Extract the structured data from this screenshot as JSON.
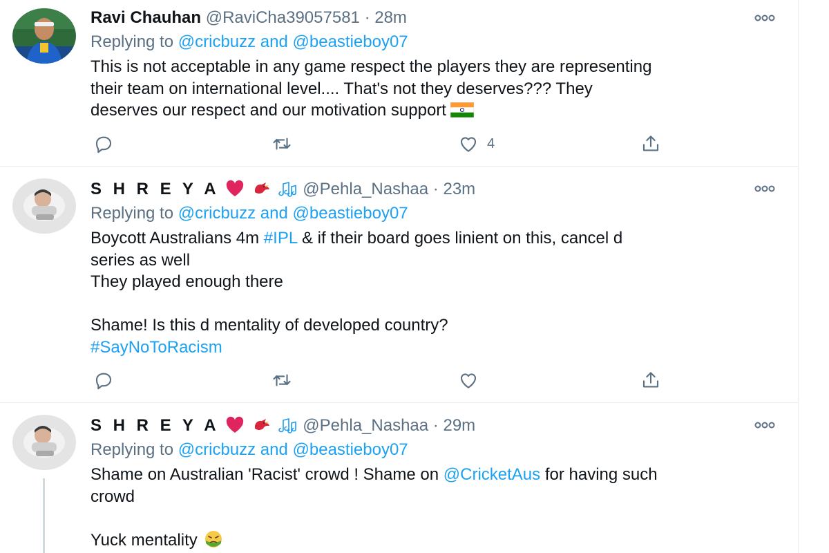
{
  "tweets": [
    {
      "name": "Ravi Chauhan",
      "handle": "@RaviCha39057581",
      "dot": "·",
      "time": "28m",
      "replying_prefix": "Replying to",
      "replying_users": "@cricbuzz and @beastieboy07",
      "body_lines": [
        "This is not acceptable in any game respect the players they are representing",
        "their team on international level.... That's not they deserves???  They",
        "deserves our respect and our motivation support"
      ],
      "flag_icon": "india-flag-icon",
      "like_count": "4"
    },
    {
      "name": "S H R E Y A",
      "handle": "@Pehla_Nashaa",
      "dot": "·",
      "time": "23m",
      "replying_prefix": "Replying to",
      "replying_users": "@cricbuzz and @beastieboy07",
      "line1_a": "Boycott Australians 4m",
      "line1_tag": "#IPL",
      "line1_b": "& if their board goes linient on this, cancel d",
      "line2": "series as well",
      "line3": "They played enough there",
      "line4": "Shame! Is this d mentality of developed country?",
      "line5_tag": "#SayNoToRacism",
      "like_count": ""
    },
    {
      "name": "S H R E Y A",
      "handle": "@Pehla_Nashaa",
      "dot": "·",
      "time": "29m",
      "replying_prefix": "Replying to",
      "replying_users": "@cricbuzz and @beastieboy07",
      "line1_a": "Shame on Australian 'Racist' crowd ! Shame on",
      "line1_mention": "@CricketAus",
      "line1_b": "for having such",
      "line2": "crowd",
      "line3": "Yuck mentality"
    }
  ],
  "colors": {
    "link": "#1da1f2",
    "secondary_text": "#5b7083",
    "divider": "#e6ecf0"
  }
}
